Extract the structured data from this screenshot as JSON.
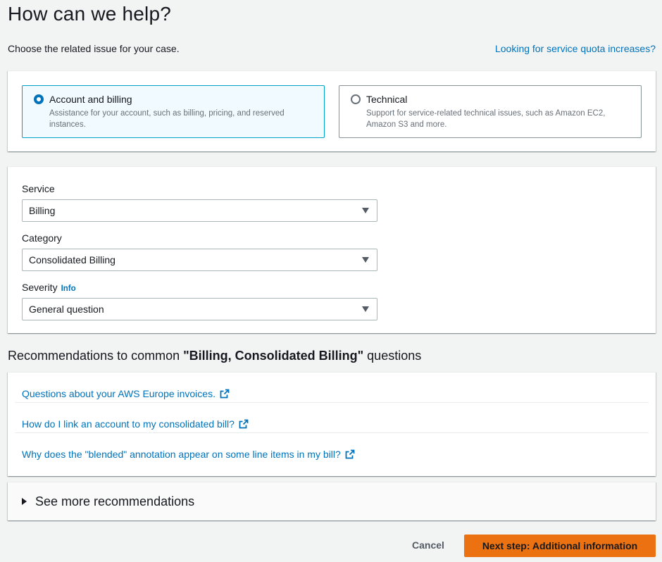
{
  "header": {
    "title": "How can we help?",
    "subtitle": "Choose the related issue for your case.",
    "quota_link": "Looking for service quota increases?"
  },
  "issue_types": [
    {
      "title": "Account and billing",
      "description": "Assistance for your account, such as billing, pricing, and reserved instances.",
      "selected": true
    },
    {
      "title": "Technical",
      "description": "Support for service-related technical issues, such as Amazon EC2, Amazon S3 and more.",
      "selected": false
    }
  ],
  "form": {
    "service": {
      "label": "Service",
      "value": "Billing"
    },
    "category": {
      "label": "Category",
      "value": "Consolidated Billing"
    },
    "severity": {
      "label": "Severity",
      "info": "Info",
      "value": "General question"
    }
  },
  "recommendations": {
    "heading_prefix": "Recommendations to common ",
    "heading_topic": "\"Billing, Consolidated Billing\"",
    "heading_suffix": " questions",
    "links": [
      "Questions about your AWS Europe invoices.",
      "How do I link an account to my consolidated bill?",
      "Why does the \"blended\" annotation appear on some line items in my bill?"
    ],
    "see_more": "See more recommendations"
  },
  "actions": {
    "cancel": "Cancel",
    "next": "Next step: Additional information"
  },
  "colors": {
    "link": "#0073bb",
    "primary": "#ec7211",
    "selected_tile_bg": "#f1faff",
    "selected_tile_border": "#00a1c9"
  }
}
